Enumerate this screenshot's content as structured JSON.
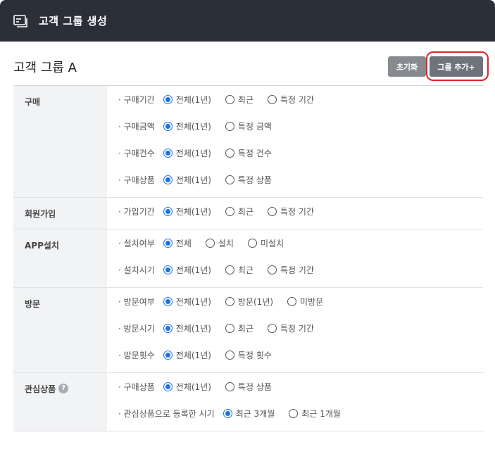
{
  "header": {
    "title": "고객 그룹 생성",
    "icon": "card-icon"
  },
  "group_title": "고객 그룹 A",
  "buttons": {
    "reset": "초기화",
    "add": "그룹 추가+"
  },
  "sections": [
    {
      "label": "구매",
      "help": false,
      "rows": [
        {
          "label": "· 구매기간",
          "options": [
            "전체(1년)",
            "최근",
            "특정 기간"
          ],
          "selected": 0
        },
        {
          "label": "· 구매금액",
          "options": [
            "전체(1년)",
            "특정 금액"
          ],
          "selected": 0
        },
        {
          "label": "· 구매건수",
          "options": [
            "전체(1년)",
            "특정 건수"
          ],
          "selected": 0
        },
        {
          "label": "· 구매상품",
          "options": [
            "전체(1년)",
            "특정 상품"
          ],
          "selected": 0
        }
      ]
    },
    {
      "label": "회원가입",
      "help": false,
      "rows": [
        {
          "label": "· 가입기간",
          "options": [
            "전체(1년)",
            "최근",
            "특정 기간"
          ],
          "selected": 0
        }
      ]
    },
    {
      "label": "APP설치",
      "help": false,
      "rows": [
        {
          "label": "· 설치여부",
          "options": [
            "전체",
            "설치",
            "미설치"
          ],
          "selected": 0
        },
        {
          "label": "· 설치시기",
          "options": [
            "전체(1년)",
            "최근",
            "특정 기간"
          ],
          "selected": 0
        }
      ]
    },
    {
      "label": "방문",
      "help": false,
      "rows": [
        {
          "label": "· 방문여부",
          "options": [
            "전체(1년)",
            "방문(1년)",
            "미방문"
          ],
          "selected": 0
        },
        {
          "label": "· 방문시기",
          "options": [
            "전체(1년)",
            "최근",
            "특정 기간"
          ],
          "selected": 0
        },
        {
          "label": "· 방문횟수",
          "options": [
            "전체(1년)",
            "특정 횟수"
          ],
          "selected": 0
        }
      ]
    },
    {
      "label": "관심상품",
      "help": true,
      "rows": [
        {
          "label": "· 구매상품",
          "options": [
            "전체(1년)",
            "특정 상품"
          ],
          "selected": 0
        },
        {
          "label": "· 관심상품으로 등록한 시기",
          "options": [
            "최근 3개월",
            "최근 1개월"
          ],
          "selected": 0
        }
      ]
    }
  ],
  "colors": {
    "header_bg": "#2b2f38",
    "radio_accent": "#1a73e8",
    "highlight": "#e0242c"
  }
}
